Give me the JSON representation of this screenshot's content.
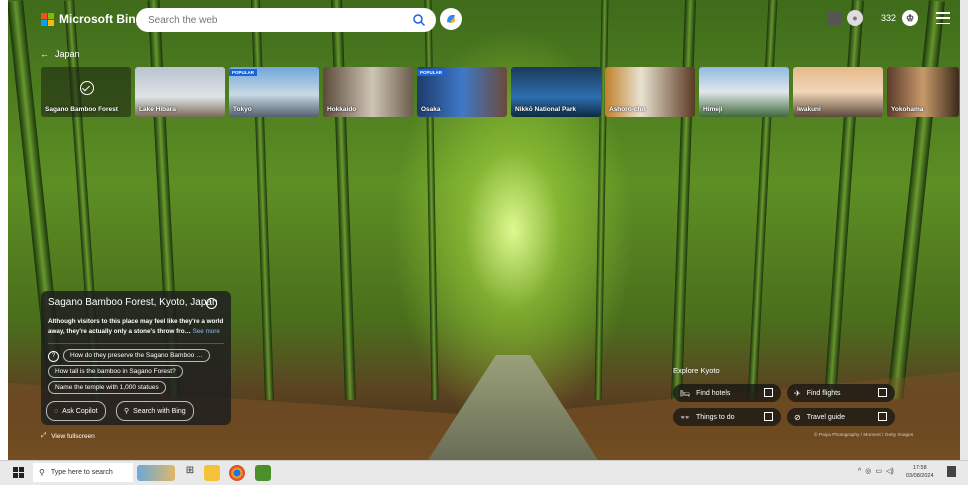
{
  "header": {
    "logo_text": "Microsoft Bing",
    "search_placeholder": "Search the web",
    "reward_points": "332"
  },
  "breadcrumb": {
    "label": "Japan"
  },
  "carousel": {
    "items": [
      {
        "label": "Sagano Bamboo Forest",
        "active": true,
        "badge": ""
      },
      {
        "label": "Lake Hibara",
        "badge": ""
      },
      {
        "label": "Tokyo",
        "badge": "POPULAR"
      },
      {
        "label": "Hokkaido",
        "badge": ""
      },
      {
        "label": "Osaka",
        "badge": "POPULAR"
      },
      {
        "label": "Nikkō National Park",
        "badge": ""
      },
      {
        "label": "Ashoro-cho",
        "badge": ""
      },
      {
        "label": "Himeji",
        "badge": ""
      },
      {
        "label": "Iwakuni",
        "badge": ""
      },
      {
        "label": "Yokohama",
        "badge": ""
      }
    ]
  },
  "info": {
    "title": "Sagano Bamboo Forest, Kyoto, Japan",
    "description": "Although visitors to this place may feel like they're a world away, they're actually only a stone's throw fro…",
    "see_more": "See more",
    "questions": [
      "How do they preserve the Sagano Bamboo …",
      "How tall is the bamboo in Sagano Forest?",
      "Name the temple with 1,000 statues"
    ],
    "ask_copilot": "Ask Copilot",
    "search_bing": "Search with Bing",
    "fullscreen": "View fullscreen"
  },
  "explore": {
    "title": "Explore Kyoto",
    "hotels": "Find hotels",
    "flights": "Find flights",
    "things": "Things to do",
    "guide": "Travel guide"
  },
  "credit": "© Paiya Photography / Moment / Getty Images",
  "taskbar": {
    "search_placeholder": "Type here to search",
    "time": "17:58",
    "date": "03/08/2024"
  },
  "colors": {
    "ms_red": "#f25022",
    "ms_green": "#7fba00",
    "ms_blue": "#00a4ef",
    "ms_yellow": "#ffb900",
    "popular_badge": "#1a63d8"
  }
}
